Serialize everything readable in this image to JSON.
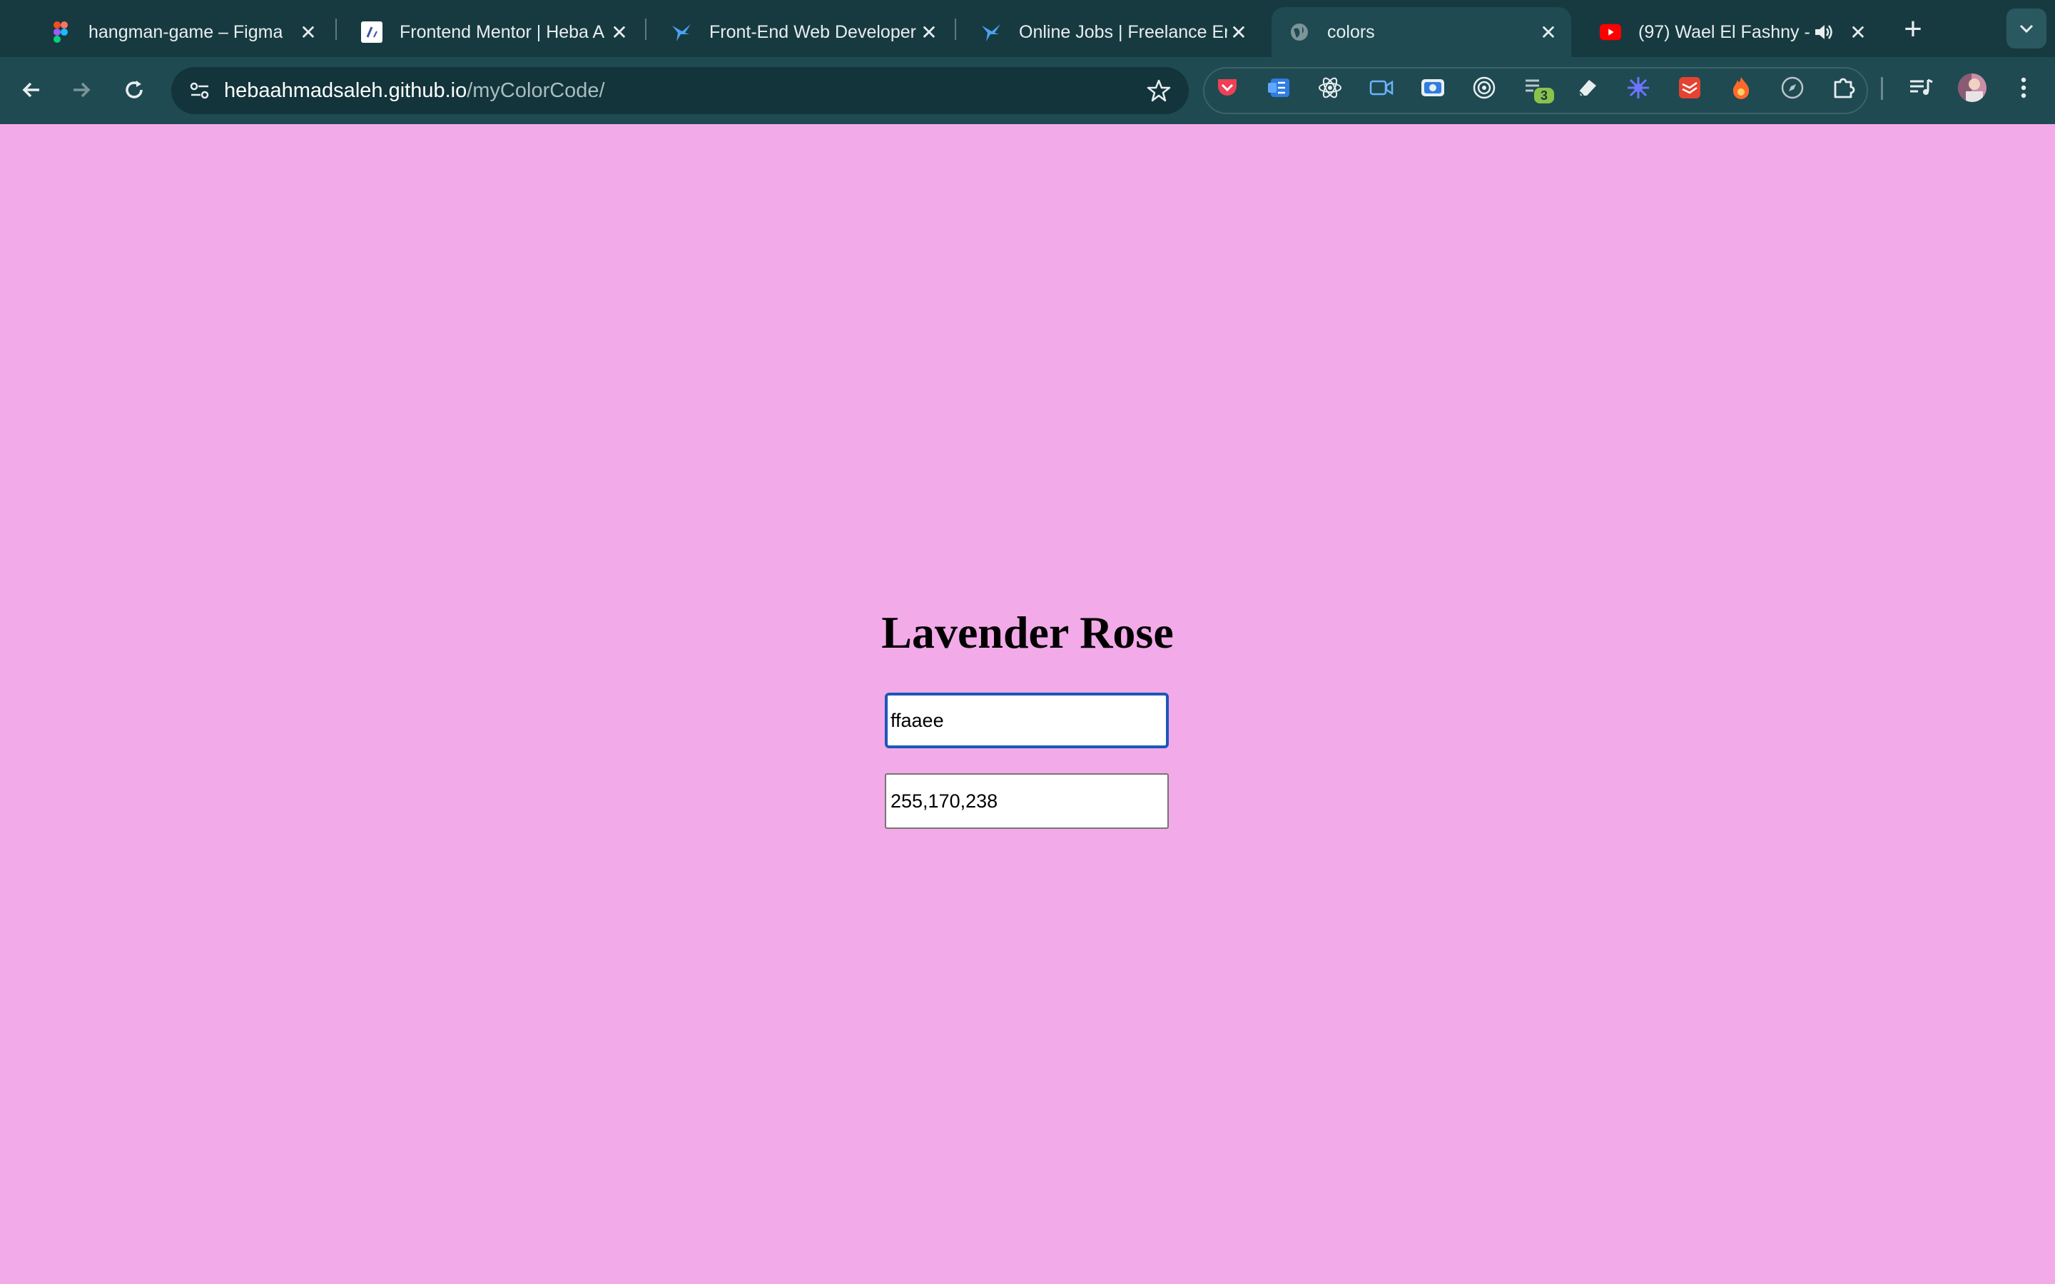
{
  "browser": {
    "tabs": [
      {
        "title": "hangman-game – Figma",
        "icon": "figma-icon"
      },
      {
        "title": "Frontend Mentor | Heba A",
        "icon": "frontend-mentor-icon"
      },
      {
        "title": "Front-End Web Developer",
        "icon": "bird-icon"
      },
      {
        "title": "Online Jobs | Freelance Er",
        "icon": "bird-icon"
      },
      {
        "title": "colors",
        "icon": "globe-icon",
        "active": true
      },
      {
        "title": "(97) Wael El Fashny - ",
        "icon": "youtube-icon",
        "audio": true
      }
    ],
    "address": {
      "domain": "hebaahmadsaleh.github.io",
      "path": "/myColorCode/"
    },
    "extensions": [
      {
        "name": "pocket-icon",
        "badge": ""
      },
      {
        "name": "bookmark-extension-icon",
        "badge": ""
      },
      {
        "name": "react-icon",
        "badge": ""
      },
      {
        "name": "video-camera-icon",
        "badge": ""
      },
      {
        "name": "screen-capture-icon",
        "badge": ""
      },
      {
        "name": "target-icon",
        "badge": ""
      },
      {
        "name": "notes-icon",
        "badge": "3"
      },
      {
        "name": "eraser-icon",
        "badge": ""
      },
      {
        "name": "sparkle-icon",
        "badge": ""
      },
      {
        "name": "todoist-icon",
        "badge": ""
      },
      {
        "name": "fire-icon",
        "badge": ""
      },
      {
        "name": "compass-icon",
        "badge": ""
      },
      {
        "name": "puzzle-icon",
        "badge": ""
      }
    ]
  },
  "page": {
    "color_name": "Lavender Rose",
    "hex_value": "ffaaee",
    "rgb_value": "255,170,238",
    "background_color": "#f2aae8"
  }
}
